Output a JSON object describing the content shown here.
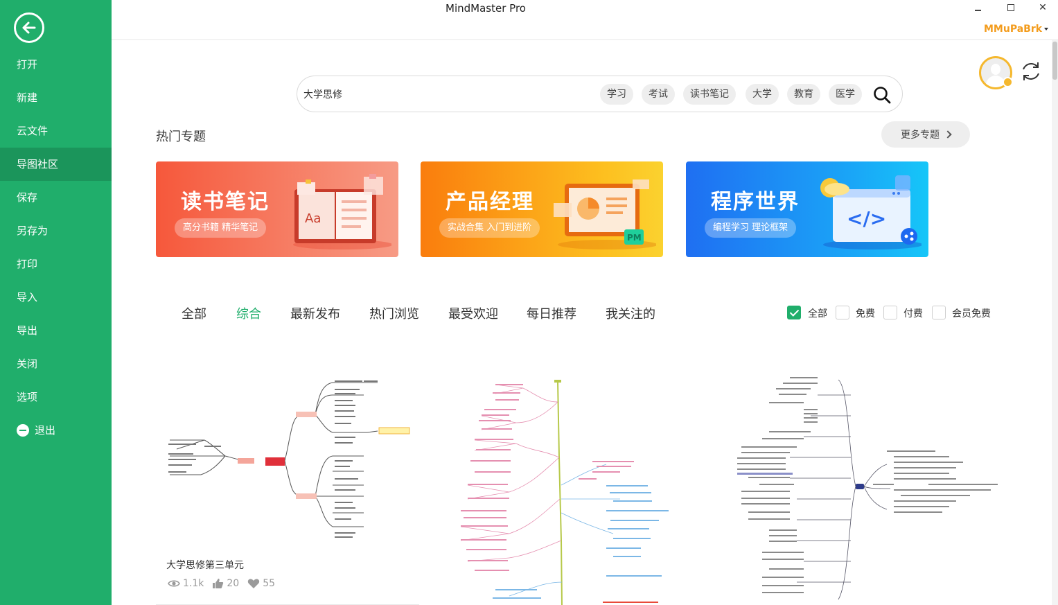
{
  "window": {
    "title": "MindMaster Pro",
    "user_name": "MMuPaBrk",
    "minimize_label": "",
    "maximize_label": "",
    "close_label": "✕"
  },
  "sidebar": {
    "items": [
      {
        "label": "打开"
      },
      {
        "label": "新建"
      },
      {
        "label": "云文件"
      },
      {
        "label": "导图社区",
        "active": true
      },
      {
        "label": "保存"
      },
      {
        "label": "另存为"
      },
      {
        "label": "打印"
      },
      {
        "label": "导入"
      },
      {
        "label": "导出"
      },
      {
        "label": "关闭"
      },
      {
        "label": "选项"
      },
      {
        "label": "退出"
      }
    ]
  },
  "search": {
    "value": "大学思修",
    "tags": [
      "学习",
      "考试",
      "读书笔记",
      "大学",
      "教育",
      "医学"
    ]
  },
  "hot_topics": {
    "title": "热门专题",
    "more_label": "更多专题",
    "banners": [
      {
        "title": "读书笔记",
        "subtitle": "高分书籍 精华笔记",
        "art_text": "Aa"
      },
      {
        "title": "产品经理",
        "subtitle": "实战合集 入门到进阶",
        "art_text": "PM"
      },
      {
        "title": "程序世界",
        "subtitle": "编程学习 理论框架",
        "art_text": "</>"
      }
    ]
  },
  "filters": {
    "tabs": [
      "全部",
      "综合",
      "最新发布",
      "热门浏览",
      "最受欢迎",
      "每日推荐",
      "我关注的"
    ],
    "active_tab": "综合",
    "price_options": [
      {
        "label": "全部",
        "checked": true
      },
      {
        "label": "免费",
        "checked": false
      },
      {
        "label": "付费",
        "checked": false
      },
      {
        "label": "会员免费",
        "checked": false
      }
    ]
  },
  "cards": [
    {
      "title": "大学思修第三单元",
      "views": "1.1k",
      "likes": "20",
      "favorites": "55"
    }
  ],
  "colors": {
    "brand_green": "#20ae6b",
    "user_orange": "#f39c1d"
  }
}
